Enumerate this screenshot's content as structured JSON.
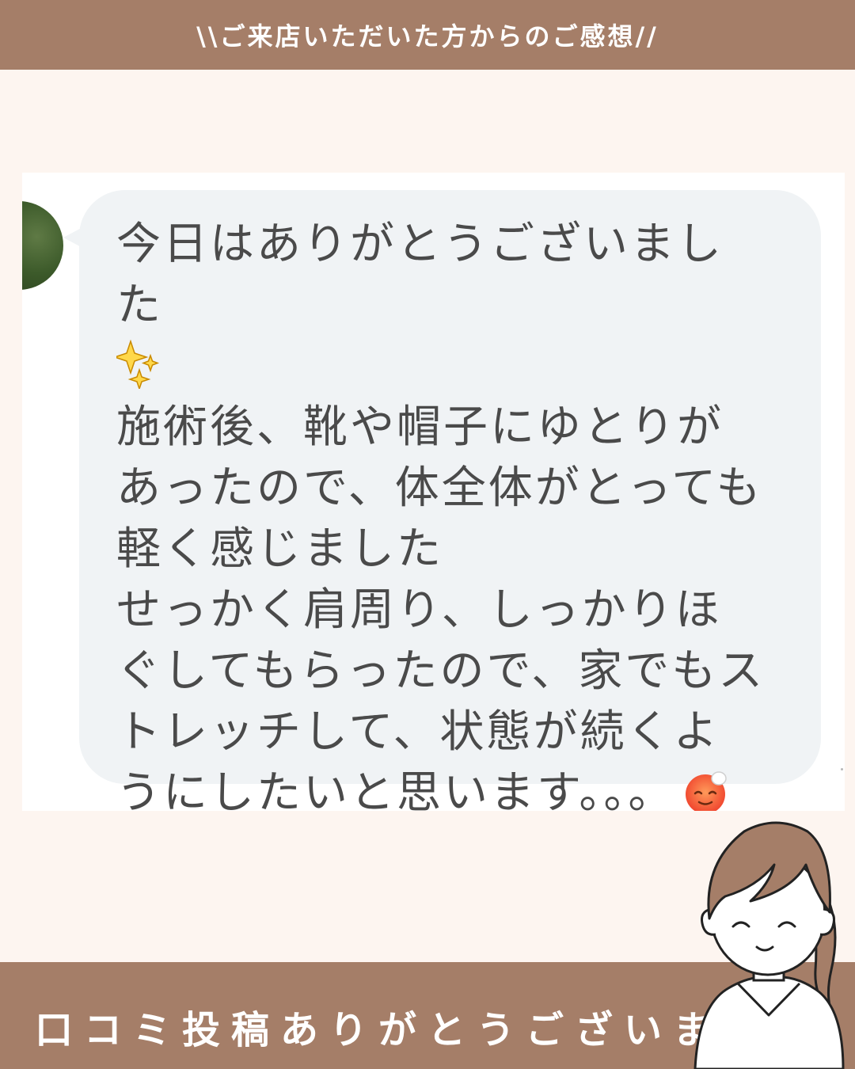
{
  "header": {
    "title": "\\\\ご来店いただいた方からのご感想//"
  },
  "review": {
    "line1": "今日はありがとうございました",
    "body": "施術後、靴や帽子にゆとりがあったので、体全体がとっても軽く感じました\nせっかく肩周り、しっかりほぐしてもらったので、家でもストレッチして、状態が続くようにしたいと思います。。。",
    "start_icon": "sparkles-icon",
    "end_icon": "hot-face-icon"
  },
  "footer": {
    "label": "口コミ投稿ありがとうございます"
  },
  "colors": {
    "banner": "#a57e68",
    "page_background": "#fdf5f0",
    "bubble": "#f0f3f5",
    "text": "#4a4a4a"
  }
}
